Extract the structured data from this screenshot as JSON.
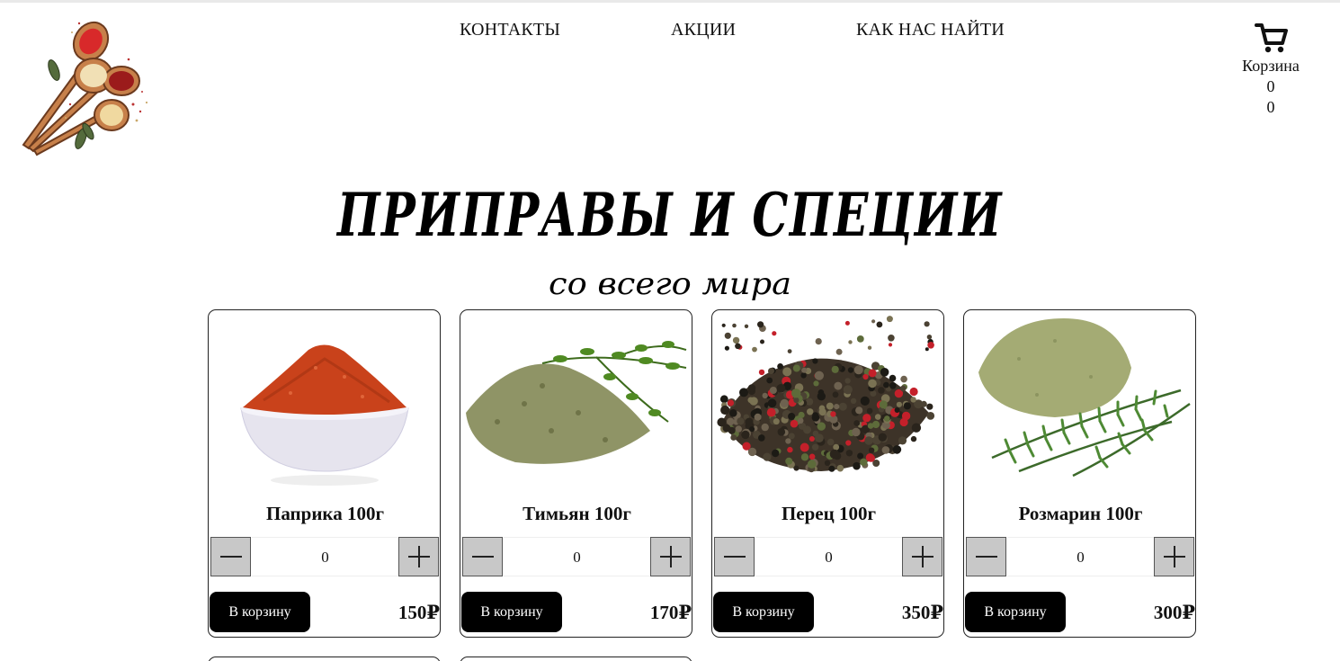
{
  "nav": {
    "items": [
      {
        "label": "КОНТАКТЫ"
      },
      {
        "label": "АКЦИИ"
      },
      {
        "label": "КАК НАС НАЙТИ"
      }
    ]
  },
  "cart": {
    "label": "Корзина",
    "count": "0",
    "total": "0",
    "icon": "cart-icon"
  },
  "hero": {
    "title": "ПРИПРАВЫ И СПЕЦИИ",
    "subtitle": "со всего мира"
  },
  "products": [
    {
      "name": "Паприка 100г",
      "qty": "0",
      "add_label": "В корзину",
      "price": "150₽",
      "image": "paprika-image"
    },
    {
      "name": "Тимьян 100г",
      "qty": "0",
      "add_label": "В корзину",
      "price": "170₽",
      "image": "thyme-image"
    },
    {
      "name": "Перец 100г",
      "qty": "0",
      "add_label": "В корзину",
      "price": "350₽",
      "image": "pepper-image"
    },
    {
      "name": "Розмарин 100г",
      "qty": "0",
      "add_label": "В корзину",
      "price": "300₽",
      "image": "rosemary-image"
    }
  ],
  "colors": {
    "button_bg": "#000000",
    "stepper_bg": "#c8c8c8",
    "card_border": "#222222"
  }
}
